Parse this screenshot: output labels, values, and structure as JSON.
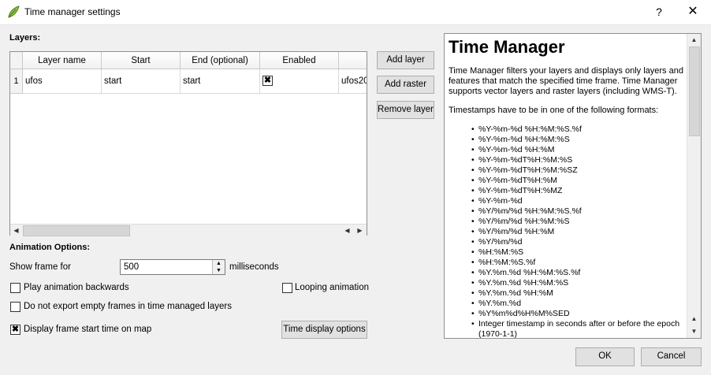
{
  "window": {
    "title": "Time manager settings",
    "help_glyph": "?",
    "close_glyph": "✕",
    "app_icon": "qgis-leaf-icon"
  },
  "layers": {
    "label": "Layers:",
    "columns": [
      "Layer name",
      "Start",
      "End (optional)",
      "Enabled",
      ""
    ],
    "rows": [
      {
        "index": "1",
        "layer_name": "ufos",
        "start": "start",
        "end": "start",
        "enabled": true,
        "extra": "ufos20"
      }
    ],
    "buttons": {
      "add_layer": "Add layer",
      "add_raster": "Add raster",
      "remove_layer": "Remove layer"
    }
  },
  "animation": {
    "label": "Animation Options:",
    "show_frame_label": "Show frame for",
    "show_frame_value": "500",
    "ms_label": "milliseconds",
    "play_backwards": {
      "label": "Play animation backwards",
      "checked": false
    },
    "looping": {
      "label": "Looping animation",
      "checked": false
    },
    "no_export_empty": {
      "label": "Do not export empty frames in time managed layers",
      "checked": false
    },
    "display_start_time": {
      "label": "Display frame start time on map",
      "checked": true
    },
    "time_display_options": "Time display options"
  },
  "help": {
    "title": "Time Manager",
    "paragraph1": "Time Manager filters your layers and displays only layers and features that match the specified time frame. Time Manager supports vector layers and raster layers (including WMS-T).",
    "paragraph2": "Timestamps have to be in one of the following formats:",
    "formats": [
      "%Y-%m-%d %H:%M:%S.%f",
      "%Y-%m-%d %H:%M:%S",
      "%Y-%m-%d %H:%M",
      "%Y-%m-%dT%H:%M:%S",
      "%Y-%m-%dT%H:%M:%SZ",
      "%Y-%m-%dT%H:%M",
      "%Y-%m-%dT%H:%MZ",
      "%Y-%m-%d",
      "%Y/%m/%d %H:%M:%S.%f",
      "%Y/%m/%d %H:%M:%S",
      "%Y/%m/%d %H:%M",
      "%Y/%m/%d",
      "%H:%M:%S",
      "%H:%M:%S.%f",
      "%Y.%m.%d %H:%M:%S.%f",
      "%Y.%m.%d %H:%M:%S",
      "%Y.%m.%d %H:%M",
      "%Y.%m.%d",
      "%Y%m%d%H%M%SED",
      "Integer timestamp in seconds after or before the epoch (1970-1-1)"
    ]
  },
  "footer": {
    "ok": "OK",
    "cancel": "Cancel"
  }
}
